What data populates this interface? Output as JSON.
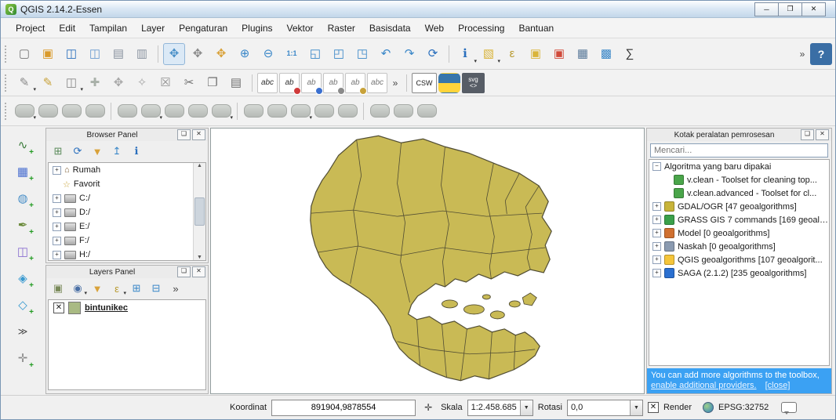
{
  "window": {
    "title": "QGIS 2.14.2-Essen",
    "controls": {
      "minimize": "─",
      "restore": "❐",
      "close": "✕"
    }
  },
  "menu": {
    "items": [
      "Project",
      "Edit",
      "Tampilan",
      "Layer",
      "Pengaturan",
      "Plugins",
      "Vektor",
      "Raster",
      "Basisdata",
      "Web",
      "Processing",
      "Bantuan"
    ]
  },
  "colors": {
    "map_fill": "#c9ba55",
    "map_stroke": "#504c33",
    "notice_bg": "#3ba1f3",
    "accent_blue": "#3a87c8"
  },
  "toolbar1": [
    {
      "handle": true
    },
    {
      "name": "new-project-button",
      "glyph": "▢",
      "color": "#777777"
    },
    {
      "name": "open-project-button",
      "glyph": "▣",
      "color": "#d99a2b"
    },
    {
      "name": "save-project-button",
      "glyph": "◫",
      "color": "#2a6fbd"
    },
    {
      "name": "save-project-as-button",
      "glyph": "◫",
      "color": "#6a9ad0"
    },
    {
      "name": "new-print-composer-button",
      "glyph": "▤",
      "color": "#8a93a0"
    },
    {
      "name": "composer-manager-button",
      "glyph": "▥",
      "color": "#8a93a0"
    },
    {
      "sep": true
    },
    {
      "name": "touch-zoom-pan-button",
      "glyph": "✥",
      "color": "#4a90c8",
      "pressed": true
    },
    {
      "name": "pan-map-button",
      "glyph": "✥",
      "color": "#8a8a8a"
    },
    {
      "name": "pan-to-selection-button",
      "glyph": "✥",
      "color": "#d9a23a"
    },
    {
      "name": "zoom-in-button",
      "glyph": "⊕",
      "color": "#3a87c8"
    },
    {
      "name": "zoom-out-button",
      "glyph": "⊖",
      "color": "#3a87c8"
    },
    {
      "name": "zoom-native-button",
      "glyph": "1:1",
      "color": "#3a87c8",
      "small": true
    },
    {
      "name": "zoom-full-button",
      "glyph": "◱",
      "color": "#3a87c8"
    },
    {
      "name": "zoom-to-selection-button",
      "glyph": "◰",
      "color": "#3a87c8"
    },
    {
      "name": "zoom-to-layer-button",
      "glyph": "◳",
      "color": "#3a87c8"
    },
    {
      "name": "zoom-last-button",
      "glyph": "↶",
      "color": "#3a87c8"
    },
    {
      "name": "zoom-next-button",
      "glyph": "↷",
      "color": "#3a87c8"
    },
    {
      "name": "refresh-map-button",
      "glyph": "⟳",
      "color": "#2a6fbd"
    },
    {
      "sep": true
    },
    {
      "name": "identify-features-button",
      "glyph": "ℹ",
      "color": "#2a6fbd",
      "caret": true
    },
    {
      "name": "select-features-button",
      "glyph": "▧",
      "color": "#d9b43a",
      "caret": true
    },
    {
      "name": "select-by-expression-button",
      "glyph": "ε",
      "color": "#b89a30"
    },
    {
      "name": "deselect-features-button",
      "glyph": "▣",
      "color": "#d9b43a"
    },
    {
      "name": "remove-selection-button",
      "glyph": "▣",
      "color": "#d04a3a"
    },
    {
      "name": "open-attribute-table-button",
      "glyph": "▦",
      "color": "#5a7a9a"
    },
    {
      "name": "field-calculator-button",
      "glyph": "▩",
      "color": "#3a87c8"
    },
    {
      "name": "statistical-summary-button",
      "glyph": "∑",
      "color": "#333333"
    },
    {
      "name": "toolbar1-overflow-chevron",
      "glyph": "»",
      "plain": true,
      "autoright": true
    },
    {
      "name": "help-button",
      "glyph": "?",
      "color": "#ffffff",
      "bg": "#3a6ea5"
    }
  ],
  "toolbar2": [
    {
      "handle": true
    },
    {
      "name": "current-edits-button",
      "glyph": "✎",
      "color": "#8a8a8a",
      "caret": true
    },
    {
      "name": "toggle-editing-button",
      "glyph": "✎",
      "color": "#c8a23a"
    },
    {
      "name": "save-layer-edits-button",
      "glyph": "◫",
      "color": "#8a8a8a",
      "caret": true
    },
    {
      "name": "add-feature-button",
      "glyph": "✚",
      "color": "#a8b0a8"
    },
    {
      "name": "move-feature-button",
      "glyph": "✥",
      "color": "#a8a8a8"
    },
    {
      "name": "node-tool-button",
      "glyph": "✧",
      "color": "#a8a8a8"
    },
    {
      "name": "delete-selected-button",
      "glyph": "☒",
      "color": "#909090"
    },
    {
      "name": "cut-features-button",
      "glyph": "✂",
      "color": "#707070"
    },
    {
      "name": "copy-features-button",
      "glyph": "❐",
      "color": "#707070"
    },
    {
      "name": "paste-features-button",
      "glyph": "▤",
      "color": "#707070"
    },
    {
      "sep": true
    },
    {
      "name": "layer-labeling-button",
      "text": "abc",
      "color": "#333333"
    },
    {
      "name": "label-diagram-button",
      "text": "ab",
      "color": "#333333",
      "dot": "#d03a3a"
    },
    {
      "name": "label-pin-button",
      "text": "ab",
      "color": "#777777",
      "dot": "#3a6fd0"
    },
    {
      "name": "label-show-hide-button",
      "text": "ab",
      "color": "#777777",
      "dot": "#8a8a8a"
    },
    {
      "name": "label-move-button",
      "text": "ab",
      "color": "#777777",
      "dot": "#c8a23a"
    },
    {
      "name": "label-properties-button",
      "text": "abc",
      "color": "#777777"
    },
    {
      "name": "toolbar2-overflow-chevron",
      "glyph": "»",
      "plain": true
    },
    {
      "sep": true
    },
    {
      "name": "csw-button",
      "text": "CSW",
      "boxed": true
    },
    {
      "name": "python-console-button",
      "python": true
    },
    {
      "name": "svg-annotation-button",
      "svgbtn": true
    }
  ],
  "toolbar3": [
    {
      "handle": true
    },
    {
      "name": "plugin-tool-01-button",
      "blob": true,
      "caret": true
    },
    {
      "name": "plugin-tool-02-button",
      "blob": true
    },
    {
      "name": "plugin-tool-03-button",
      "blob": true
    },
    {
      "name": "plugin-tool-04-button",
      "blob": true
    },
    {
      "sep": true
    },
    {
      "name": "plugin-tool-05-button",
      "blob": true
    },
    {
      "name": "plugin-tool-06-button",
      "blob": true,
      "caret": true
    },
    {
      "name": "plugin-tool-07-button",
      "blob": true
    },
    {
      "name": "plugin-tool-08-button",
      "blob": true
    },
    {
      "name": "plugin-tool-09-button",
      "blob": true,
      "caret": true
    },
    {
      "sep": true
    },
    {
      "name": "plugin-tool-10-button",
      "blob": true
    },
    {
      "name": "plugin-tool-11-button",
      "blob": true
    },
    {
      "name": "plugin-tool-12-button",
      "blob": true,
      "caret": true
    },
    {
      "name": "plugin-tool-13-button",
      "blob": true
    },
    {
      "name": "plugin-tool-14-button",
      "blob": true
    },
    {
      "sep": true
    },
    {
      "name": "plugin-tool-15-button",
      "blob": true
    },
    {
      "name": "plugin-tool-16-button",
      "blob": true
    },
    {
      "name": "plugin-tool-17-button",
      "blob": true
    }
  ],
  "left_toolbar": [
    {
      "name": "add-vector-layer-button",
      "glyph": "∿",
      "color": "#3a7a3a",
      "plus": true
    },
    {
      "name": "add-raster-layer-button",
      "glyph": "▦",
      "color": "#4a6fd0",
      "plus": true
    },
    {
      "name": "add-postgis-layer-button",
      "glyph": "◍",
      "color": "#4a90c8",
      "plus": true
    },
    {
      "name": "add-spatialite-layer-button",
      "glyph": "✒",
      "color": "#6a8a3a",
      "plus": true
    },
    {
      "name": "add-mssql-layer-button",
      "glyph": "◫",
      "color": "#8a6fd0",
      "plus": true
    },
    {
      "name": "add-wms-layer-button",
      "glyph": "◈",
      "color": "#3a9ad0",
      "plus": true
    },
    {
      "name": "add-delimited-text-layer-button",
      "glyph": "◇",
      "color": "#3a9ad0",
      "plus": true
    },
    {
      "name": "left-toolbar-overflow-chevron",
      "glyph": "≫",
      "plain": true
    },
    {
      "name": "new-shapefile-layer-button",
      "glyph": "✛",
      "color": "#8a8a8a",
      "plus": true
    }
  ],
  "browser_panel": {
    "title": "Browser Panel",
    "toolbar": [
      {
        "name": "add-selected-layers-button",
        "glyph": "⊞",
        "color": "#5a8a5a"
      },
      {
        "name": "refresh-browser-button",
        "glyph": "⟳",
        "color": "#2a6fbd"
      },
      {
        "name": "filter-browser-button",
        "glyph": "▼",
        "color": "#d9a23a"
      },
      {
        "name": "collapse-all-button",
        "glyph": "↥",
        "color": "#3a87c8"
      },
      {
        "name": "properties-widget-button",
        "glyph": "ℹ",
        "color": "#2a6fbd"
      }
    ],
    "items": [
      {
        "label": "Rumah",
        "icon": "home",
        "expand": true
      },
      {
        "label": "Favorit",
        "icon": "star",
        "expand": false
      },
      {
        "label": "C:/",
        "icon": "drive",
        "expand": true
      },
      {
        "label": "D:/",
        "icon": "drive",
        "expand": true
      },
      {
        "label": "E:/",
        "icon": "drive",
        "expand": true
      },
      {
        "label": "F:/",
        "icon": "drive",
        "expand": true
      },
      {
        "label": "H:/",
        "icon": "drive",
        "expand": true
      }
    ]
  },
  "layers_panel": {
    "title": "Layers Panel",
    "toolbar": [
      {
        "name": "add-group-button",
        "glyph": "▣",
        "color": "#7a8a5a"
      },
      {
        "name": "manage-layer-visibility-button",
        "glyph": "◉",
        "color": "#4a6fa5",
        "caret": true
      },
      {
        "name": "filter-legend-button",
        "glyph": "▼",
        "color": "#d9a23a"
      },
      {
        "name": "filter-by-expression-button",
        "glyph": "ε",
        "color": "#b89a30",
        "caret": true
      },
      {
        "name": "expand-all-button",
        "glyph": "⊞",
        "color": "#3a87c8"
      },
      {
        "name": "collapse-all-layers-button",
        "glyph": "⊟",
        "color": "#3a87c8"
      },
      {
        "name": "layers-overflow-chevron",
        "glyph": "»",
        "plain": true
      }
    ],
    "layers": [
      {
        "label": "bintunikec",
        "checked": true,
        "swatch": "#a9ba83"
      }
    ]
  },
  "toolbox": {
    "title": "Kotak peralatan pemrosesan",
    "search_placeholder": "Mencari...",
    "icon_colors": {
      "grass-alg": "#4aa54a",
      "gdal": "#c8b43a",
      "grass": "#3aa04a",
      "model": "#d07030",
      "script": "#8a9ab0",
      "qgis": "#f5c53a",
      "saga": "#2a6fd0"
    },
    "tree": [
      {
        "name": "toolbox-recent-group",
        "expander": "minus",
        "indent": 0,
        "icon": null,
        "label": "Algoritma yang baru dipakai"
      },
      {
        "name": "toolbox-vclean-item",
        "expander": null,
        "indent": 1,
        "icon": "grass-alg",
        "label": "v.clean - Toolset for cleaning top..."
      },
      {
        "name": "toolbox-vclean-advanced-item",
        "expander": null,
        "indent": 1,
        "icon": "grass-alg",
        "label": "v.clean.advanced - Toolset for cl..."
      },
      {
        "name": "toolbox-gdal-group",
        "expander": "plus",
        "indent": 0,
        "icon": "gdal",
        "label": "GDAL/OGR [47 geoalgorithms]"
      },
      {
        "name": "toolbox-grass7-group",
        "expander": "plus",
        "indent": 0,
        "icon": "grass",
        "label": "GRASS GIS 7 commands [169 geoalg..."
      },
      {
        "name": "toolbox-model-group",
        "expander": "plus",
        "indent": 0,
        "icon": "model",
        "label": "Model [0 geoalgorithms]"
      },
      {
        "name": "toolbox-script-group",
        "expander": "plus",
        "indent": 0,
        "icon": "script",
        "label": "Naskah [0 geoalgorithms]"
      },
      {
        "name": "toolbox-qgis-group",
        "expander": "plus",
        "indent": 0,
        "icon": "qgis",
        "label": "QGIS geoalgorithms [107 geoalgorit..."
      },
      {
        "name": "toolbox-saga-group",
        "expander": "plus",
        "indent": 0,
        "icon": "saga",
        "label": "SAGA (2.1.2) [235 geoalgorithms]"
      }
    ],
    "notice": {
      "line1": "You can add more algorithms to the toolbox,",
      "link1": "enable additional providers.",
      "link2": "[close]"
    }
  },
  "statusbar": {
    "coordinate_label": "Koordinat",
    "coordinate_value": "891904,9878554",
    "scale_label": "Skala",
    "scale_value": "1:2.458.685",
    "rotation_label": "Rotasi",
    "rotation_value": "0,0",
    "render_label": "Render",
    "render_checked": true,
    "epsg_label": "EPSG:32752"
  }
}
